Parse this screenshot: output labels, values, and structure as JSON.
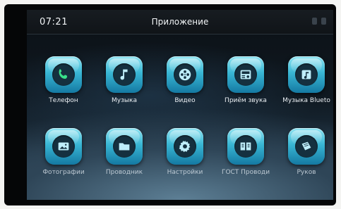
{
  "statusbar": {
    "time": "07:21",
    "title": "Приложение"
  },
  "apps_row1": [
    {
      "label": "Телефон",
      "icon": "phone-icon"
    },
    {
      "label": "Музыка",
      "icon": "music-note-icon"
    },
    {
      "label": "Видео",
      "icon": "film-reel-icon"
    },
    {
      "label": "Приём звука",
      "icon": "radio-icon"
    },
    {
      "label": "Музыка Blueto",
      "icon": "bluetooth-music-icon"
    }
  ],
  "apps_row2": [
    {
      "label": "Фотографии",
      "icon": "photo-icon"
    },
    {
      "label": "Проводник",
      "icon": "folder-icon"
    },
    {
      "label": "Настройки",
      "icon": "gear-icon"
    },
    {
      "label": "ГОСТ Проводи",
      "icon": "book-icon"
    },
    {
      "label": "Руков",
      "icon": "manual-icon"
    }
  ],
  "colors": {
    "icon_top": "#8ee4f2",
    "icon_bottom": "#1479a2",
    "glyph_bg": "#15303f"
  }
}
